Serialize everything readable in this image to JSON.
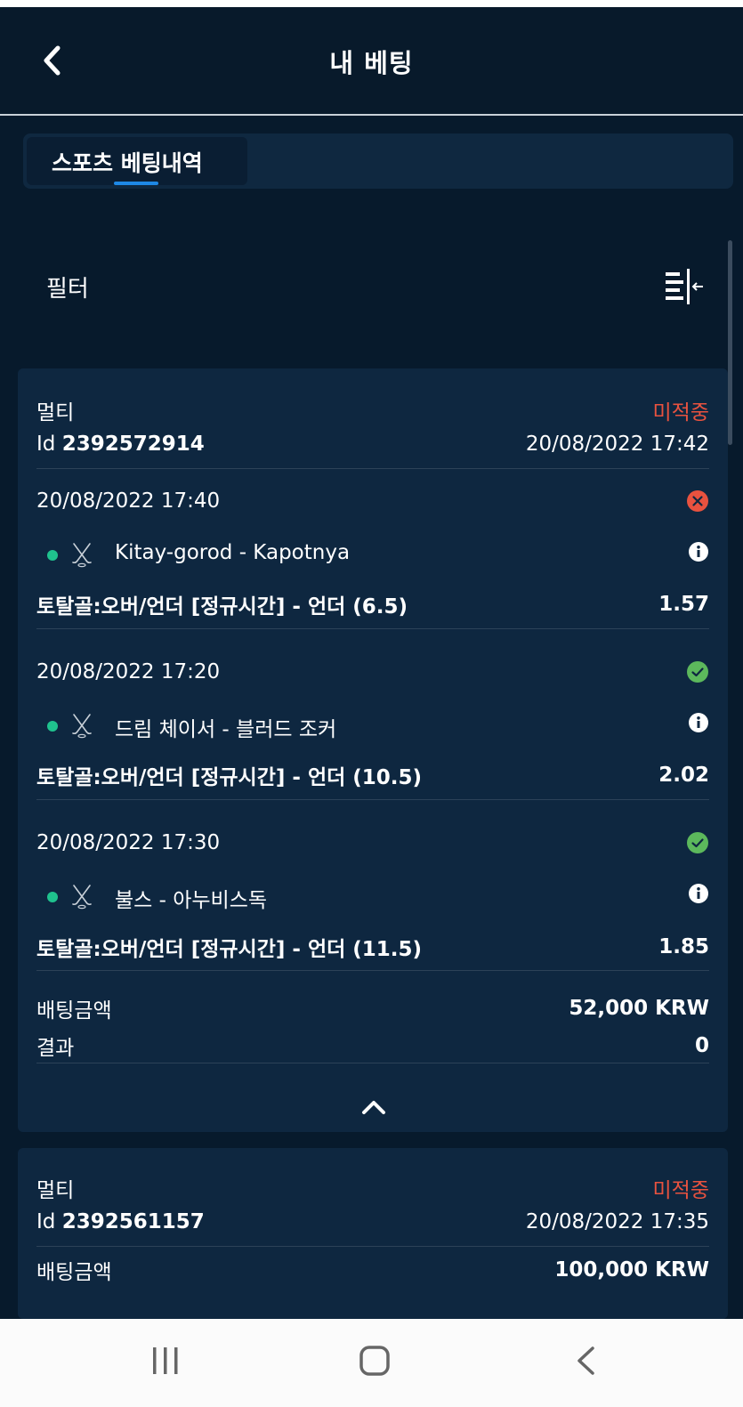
{
  "header": {
    "title": "내 베팅"
  },
  "tabs": [
    {
      "label": "스포츠 베팅내역"
    }
  ],
  "filter": {
    "label": "필터"
  },
  "bets": [
    {
      "type": "멀티",
      "status": "미적중",
      "id_prefix": "Id",
      "id": "2392572914",
      "placed": "20/08/2022 17:42",
      "selections": [
        {
          "datetime": "20/08/2022 17:40",
          "result": "lost",
          "event": "Kitay-gorod - Kapotnya",
          "market": "토탈골:오버/언더 [정규시간] - 언더 (6.5)",
          "odds": "1.57"
        },
        {
          "datetime": "20/08/2022 17:20",
          "result": "won",
          "event": "드림 체이서 - 블러드 조커",
          "market": "토탈골:오버/언더 [정규시간] - 언더 (10.5)",
          "odds": "2.02"
        },
        {
          "datetime": "20/08/2022 17:30",
          "result": "won",
          "event": "불스 - 아누비스독",
          "market": "토탈골:오버/언더 [정규시간] - 언더 (11.5)",
          "odds": "1.85"
        }
      ],
      "stake_label": "배팅금액",
      "stake": "52,000 KRW",
      "result_label": "결과",
      "result_value": "0"
    },
    {
      "type": "멀티",
      "status": "미적중",
      "id_prefix": "Id",
      "id": "2392561157",
      "placed": "20/08/2022 17:35",
      "stake_label": "배팅금액",
      "stake": "100,000 KRW"
    }
  ],
  "colors": {
    "background": "#071a2c",
    "card": "#0e2740",
    "lost": "#e8523f",
    "won": "#5cb85c",
    "live_dot": "#1fc28e",
    "tab_accent": "#1e88e5"
  },
  "icons": {
    "back": "chevron-left-icon",
    "filter": "filter-sort-icon",
    "sport": "hockey-sticks-icon",
    "info": "info-icon",
    "lost": "cross-circle-icon",
    "won": "check-circle-icon",
    "collapse": "chevron-up-icon"
  }
}
